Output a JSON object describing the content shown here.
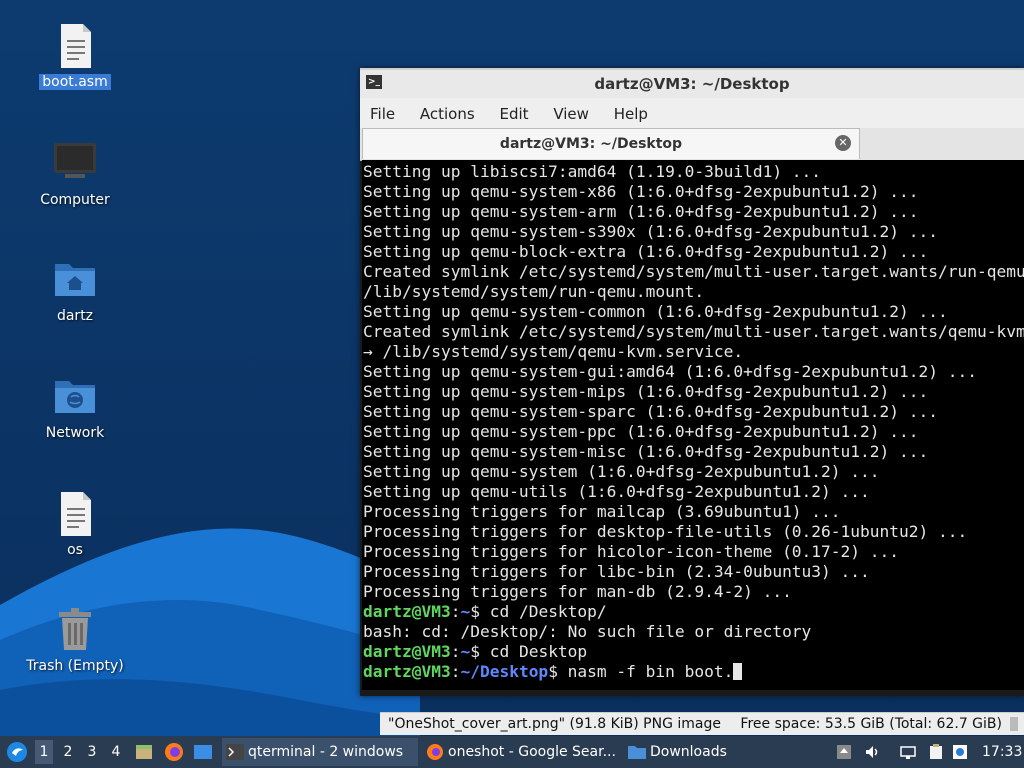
{
  "desktop": {
    "icons": [
      {
        "label": "boot.asm",
        "icon": "text-file-icon"
      },
      {
        "label": "Computer",
        "icon": "computer-icon"
      },
      {
        "label": "dartz",
        "icon": "home-folder-icon"
      },
      {
        "label": "Network",
        "icon": "network-folder-icon"
      },
      {
        "label": "os",
        "icon": "text-file-icon"
      },
      {
        "label": "Trash (Empty)",
        "icon": "trash-icon"
      }
    ]
  },
  "terminal": {
    "window_title": "dartz@VM3: ~/Desktop",
    "menu": [
      "File",
      "Actions",
      "Edit",
      "View",
      "Help"
    ],
    "tab_title": "dartz@VM3: ~/Desktop",
    "lines": [
      "Setting up libiscsi7:amd64 (1.19.0-3build1) ...",
      "Setting up qemu-system-x86 (1:6.0+dfsg-2expubuntu1.2) ...",
      "Setting up qemu-system-arm (1:6.0+dfsg-2expubuntu1.2) ...",
      "Setting up qemu-system-s390x (1:6.0+dfsg-2expubuntu1.2) ...",
      "Setting up qemu-block-extra (1:6.0+dfsg-2expubuntu1.2) ...",
      "Created symlink /etc/systemd/system/multi-user.target.wants/run-qemu.mount →",
      "/lib/systemd/system/run-qemu.mount.",
      "Setting up qemu-system-common (1:6.0+dfsg-2expubuntu1.2) ...",
      "Created symlink /etc/systemd/system/multi-user.target.wants/qemu-kvm.service",
      "→ /lib/systemd/system/qemu-kvm.service.",
      "Setting up qemu-system-gui:amd64 (1:6.0+dfsg-2expubuntu1.2) ...",
      "Setting up qemu-system-mips (1:6.0+dfsg-2expubuntu1.2) ...",
      "Setting up qemu-system-sparc (1:6.0+dfsg-2expubuntu1.2) ...",
      "Setting up qemu-system-ppc (1:6.0+dfsg-2expubuntu1.2) ...",
      "Setting up qemu-system-misc (1:6.0+dfsg-2expubuntu1.2) ...",
      "Setting up qemu-system (1:6.0+dfsg-2expubuntu1.2) ...",
      "Setting up qemu-utils (1:6.0+dfsg-2expubuntu1.2) ...",
      "Processing triggers for mailcap (3.69ubuntu1) ...",
      "Processing triggers for desktop-file-utils (0.26-1ubuntu2) ...",
      "Processing triggers for hicolor-icon-theme (0.17-2) ...",
      "Processing triggers for libc-bin (2.34-0ubuntu3) ...",
      "Processing triggers for man-db (2.9.4-2) ..."
    ],
    "prompt_lines": [
      {
        "user": "dartz@VM3",
        "path": "~",
        "cmd": " cd /Desktop/"
      },
      {
        "output": "bash: cd: /Desktop/: No such file or directory"
      },
      {
        "user": "dartz@VM3",
        "path": "~",
        "cmd": " cd Desktop"
      },
      {
        "user": "dartz@VM3",
        "path": "~/Desktop",
        "cmd": " nasm -f bin boot."
      }
    ]
  },
  "file_manager_status": {
    "selection": "\"OneShot_cover_art.png\" (91.8 KiB) PNG image",
    "free_space": "Free space: 53.5 GiB (Total: 62.7 GiB)"
  },
  "taskbar": {
    "workspaces": [
      "1",
      "2",
      "3",
      "4"
    ],
    "tasks": [
      {
        "label": "qterminal - 2 windows",
        "icon": "terminal-icon"
      },
      {
        "label": "oneshot - Google Sear...",
        "icon": "firefox-icon"
      },
      {
        "label": "Downloads",
        "icon": "folder-icon"
      }
    ],
    "clock": "17:33"
  }
}
